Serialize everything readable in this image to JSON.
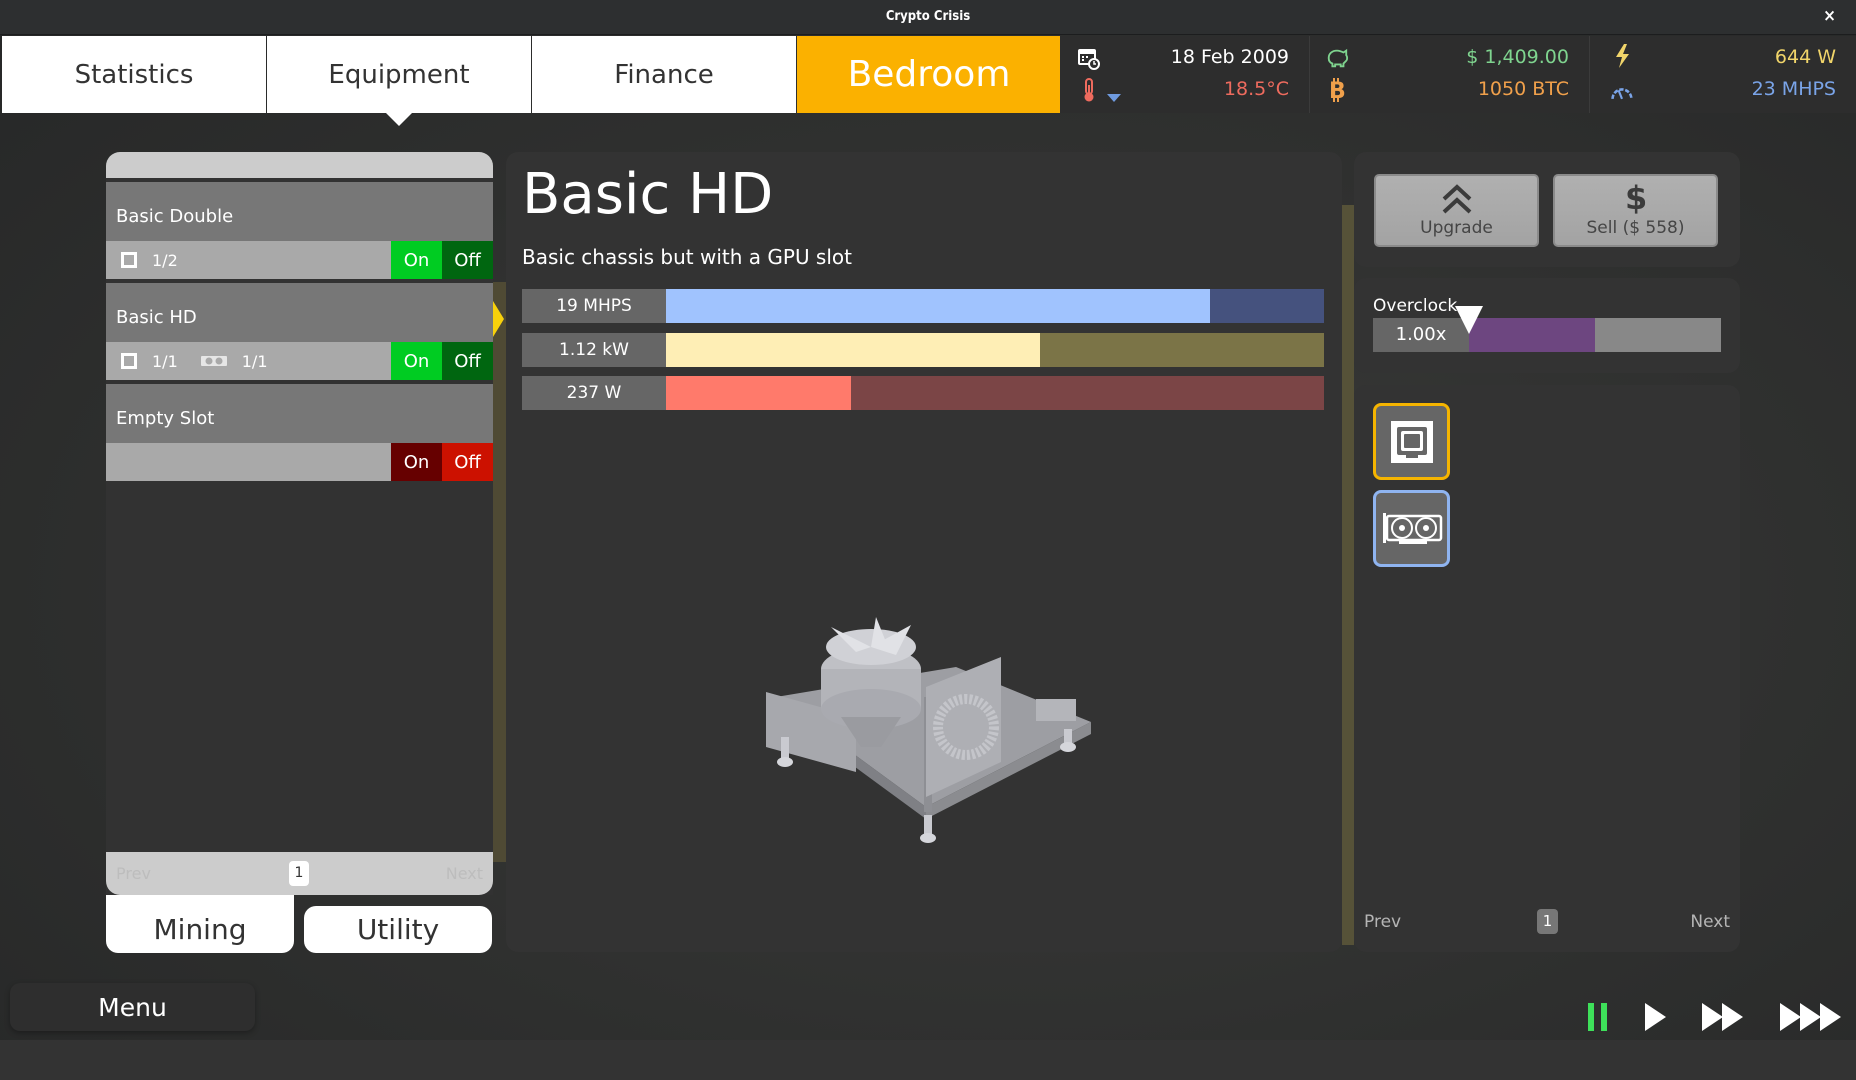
{
  "window": {
    "title": "Crypto Crisis",
    "close_glyph": "×"
  },
  "tabs": [
    {
      "label": "Statistics"
    },
    {
      "label": "Equipment",
      "active": true
    },
    {
      "label": "Finance"
    },
    {
      "label": "Bedroom",
      "location": true
    }
  ],
  "stats": {
    "date": "18 Feb 2009",
    "temperature": "18.5°C",
    "cash": "$ 1,409.00",
    "btc": "1050 BTC",
    "power": "644 W",
    "hashrate": "23 MHPS",
    "icons": [
      "calendar-clock-icon",
      "thermometer-icon",
      "dropdown-arrow-icon",
      "piggy-bank-icon",
      "bitcoin-icon",
      "lightning-icon",
      "speedometer-icon"
    ],
    "colors": {
      "cash": "#7fd48f",
      "btc": "#f0a04b",
      "temperature": "#ee6b5e",
      "power": "#f1d56a",
      "hashrate": "#7aa4e8"
    }
  },
  "rig_list": {
    "rigs": [
      {
        "name": "Basic Double",
        "slots": [
          {
            "icon": "cpu-icon",
            "count": "1/2"
          }
        ],
        "on_label": "On",
        "off_label": "Off",
        "state": "on"
      },
      {
        "name": "Basic HD",
        "slots": [
          {
            "icon": "cpu-icon",
            "count": "1/1"
          },
          {
            "icon": "gpu-icon",
            "count": "1/1"
          }
        ],
        "on_label": "On",
        "off_label": "Off",
        "state": "on",
        "selected": true
      },
      {
        "name": "Empty Slot",
        "slots": [],
        "on_label": "On",
        "off_label": "Off",
        "state": "off"
      }
    ],
    "pager": {
      "prev": "Prev",
      "page": "1",
      "next": "Next"
    },
    "categories": [
      {
        "label": "Mining",
        "active": true
      },
      {
        "label": "Utility"
      }
    ]
  },
  "detail": {
    "name": "Basic HD",
    "description": "Basic chassis but with a GPU slot",
    "bars": [
      {
        "label": "19 MHPS",
        "fraction": 0.827,
        "fill": "#a0c3fe",
        "track": "#45527e"
      },
      {
        "label": "1.12 kW",
        "fraction": 0.568,
        "fill": "#feeeb5",
        "track": "#7b7447"
      },
      {
        "label": "237 W",
        "fraction": 0.281,
        "fill": "#ff7a6b",
        "track": "#7b4546"
      }
    ]
  },
  "actions": {
    "upgrade_label": "Upgrade",
    "sell_label": "Sell ($ 558)"
  },
  "overclock": {
    "label": "Overclock",
    "value": "1.00x",
    "fraction": 0.5
  },
  "parts": {
    "items": [
      {
        "icon": "cpu-icon",
        "border": "#f5b400"
      },
      {
        "icon": "gpu-icon",
        "border": "#8fb4f0"
      }
    ],
    "pager": {
      "prev": "Prev",
      "page": "1",
      "next": "Next"
    }
  },
  "bottom": {
    "menu_label": "Menu",
    "speed_controls": [
      {
        "name": "pause",
        "active": true,
        "color": "#3ee05a"
      },
      {
        "name": "play"
      },
      {
        "name": "fast-forward"
      },
      {
        "name": "fastest-forward"
      }
    ]
  }
}
